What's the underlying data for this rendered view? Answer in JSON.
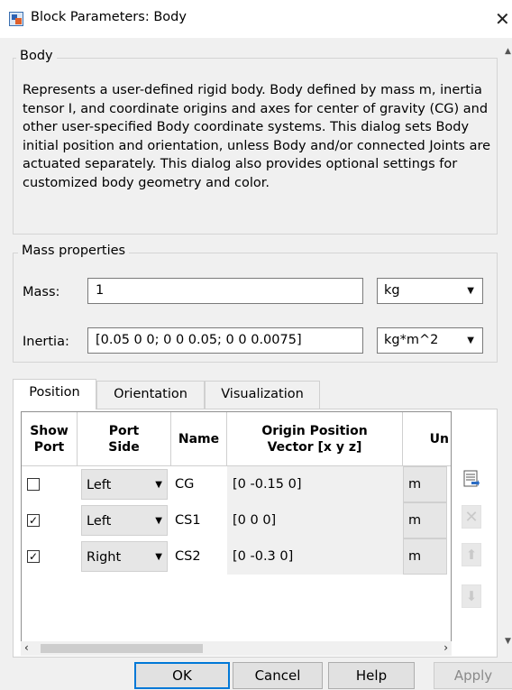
{
  "window": {
    "title": "Block Parameters: Body",
    "close_glyph": "✕"
  },
  "body_group": {
    "label": "Body",
    "description": "Represents a user-defined rigid body. Body defined by mass m, inertia tensor I, and coordinate origins and axes for center of gravity (CG) and other user-specified Body coordinate systems. This dialog sets Body initial position and orientation, unless Body and/or connected Joints are actuated separately. This dialog also provides optional settings for customized body geometry and color."
  },
  "mass_properties": {
    "label": "Mass properties",
    "mass_label": "Mass:",
    "mass_value": "1",
    "mass_unit": "kg",
    "inertia_label": "Inertia:",
    "inertia_value": "[0.05 0 0; 0 0 0.05; 0 0 0.0075]",
    "inertia_unit": "kg*m^2"
  },
  "tabs": [
    {
      "label": "Position",
      "active": true
    },
    {
      "label": "Orientation",
      "active": false
    },
    {
      "label": "Visualization",
      "active": false
    }
  ],
  "table": {
    "headers": {
      "show_port": "Show\nPort",
      "port_side": "Port\nSide",
      "name": "Name",
      "origin": "Origin Position\nVector [x y z]",
      "units": "Un"
    },
    "rows": [
      {
        "show": false,
        "show_glyph": "",
        "side": "Left",
        "name": "CG",
        "vector": "[0 -0.15 0]",
        "unit": "m"
      },
      {
        "show": true,
        "show_glyph": "✓",
        "side": "Left",
        "name": "CS1",
        "vector": "[0 0 0]",
        "unit": "m"
      },
      {
        "show": true,
        "show_glyph": "✓",
        "side": "Right",
        "name": "CS2",
        "vector": "[0 -0.3 0]",
        "unit": "m"
      }
    ]
  },
  "side_toolbar": {
    "icons": [
      "add-row-icon",
      "delete-row-icon",
      "move-up-icon",
      "move-down-icon"
    ],
    "enabled": [
      true,
      false,
      false,
      false
    ]
  },
  "footer_buttons": {
    "ok": "OK",
    "cancel": "Cancel",
    "help": "Help",
    "apply": "Apply"
  },
  "colors": {
    "accent": "#0078d7",
    "background": "#f0f0f0"
  }
}
